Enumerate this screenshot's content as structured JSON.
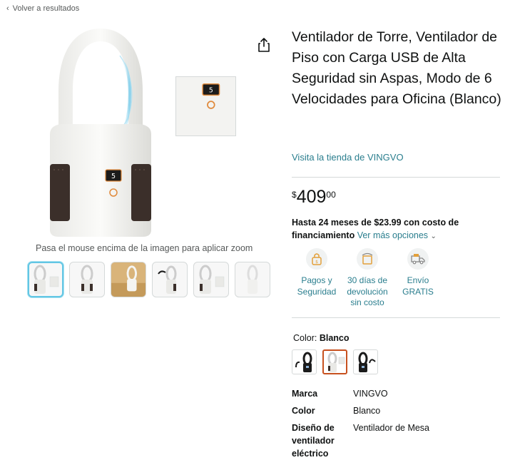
{
  "nav": {
    "back_label": "Volver a resultados"
  },
  "gallery": {
    "zoom_hint": "Pasa el mouse encima de la imagen para aplicar zoom",
    "display_digit": "5",
    "thumbnails": [
      "thumb-1",
      "thumb-2",
      "thumb-3",
      "thumb-4",
      "thumb-5",
      "thumb-6"
    ]
  },
  "product": {
    "title": "Ventilador de Torre, Ventilador de Piso con Carga USB de Alta Seguridad sin Aspas, Modo de 6 Velocidades para Oficina (Blanco)",
    "store_link": "Visita la tienda de VINGVO"
  },
  "price": {
    "symbol": "$",
    "whole": "409",
    "fraction": "00"
  },
  "financing": {
    "bold_text": "Hasta 24 meses de $23.99 con costo de financiamiento",
    "more_link": "Ver más opciones"
  },
  "badges": [
    {
      "icon": "secure-payment-icon",
      "label": "Pagos y Seguridad"
    },
    {
      "icon": "return-icon",
      "label": "30 días de devolución sin costo"
    },
    {
      "icon": "delivery-truck-icon",
      "label": "Envío GRATIS"
    }
  ],
  "color": {
    "label": "Color:",
    "value": "Blanco"
  },
  "specs": [
    {
      "key": "Marca",
      "value": "VINGVO"
    },
    {
      "key": "Color",
      "value": "Blanco"
    },
    {
      "key": "Diseño de ventilador eléctrico",
      "value": "Ventilador de Mesa"
    }
  ],
  "colors": {
    "link": "#2a7e8e",
    "selected_border": "#c7511f",
    "active_thumb": "#62c6e4",
    "display_orange": "#e08a3c"
  }
}
